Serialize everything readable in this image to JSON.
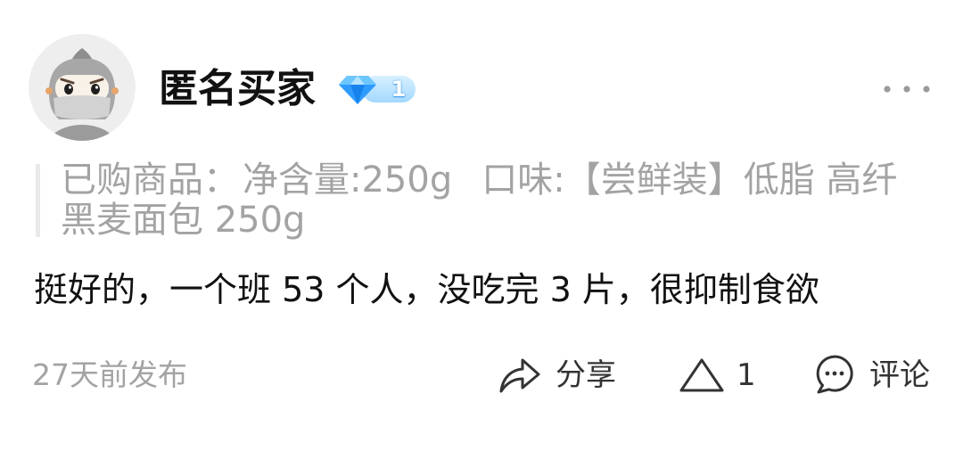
{
  "review": {
    "user": {
      "avatar_icon": "anonymous-user-avatar",
      "name": "匿名买家",
      "badge": {
        "icon": "diamond-icon",
        "level": "1"
      }
    },
    "more_icon": "more-dots-icon",
    "purchased": {
      "label": "已购商品：",
      "net_content": "净含量:250g",
      "flavor": [
        "口味:【尝鲜装】低脂 高纤",
        "黑麦面包 250g"
      ]
    },
    "content": "挺好的，一个班 53 个人，没吃完 3 片，很抑制食欲",
    "posted_time": "27天前发布",
    "actions": {
      "share": {
        "icon": "share-icon",
        "label": "分享"
      },
      "like": {
        "icon": "upvote-triangle-icon",
        "count": "1"
      },
      "comment": {
        "icon": "comment-icon",
        "label": "评论"
      }
    }
  },
  "colors": {
    "background": "#ffffff",
    "text_primary": "#111111",
    "text_secondary": "#a3a3a3",
    "action_text": "#333333",
    "quote_bar": "#e9e9e9",
    "badge_blue": "#2e9cff"
  }
}
